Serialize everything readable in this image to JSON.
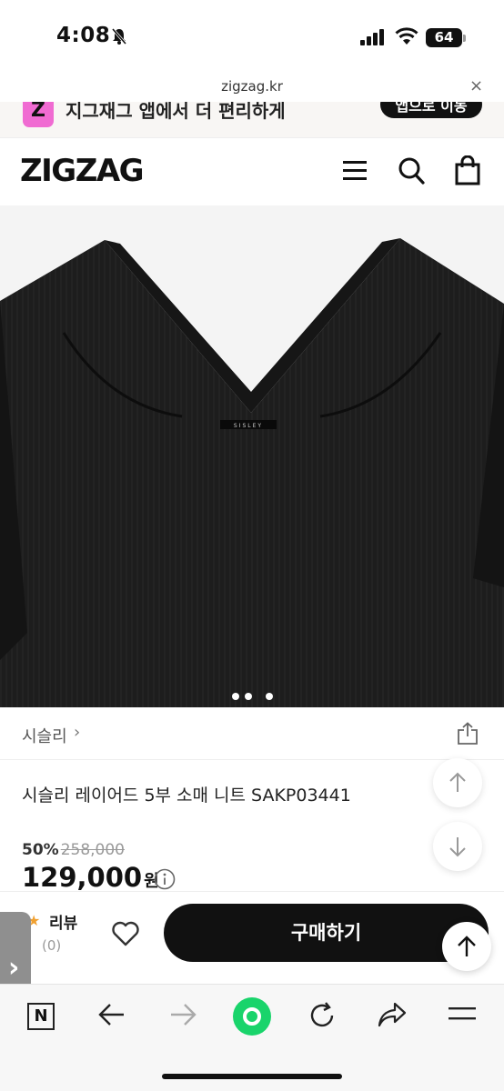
{
  "status_bar": {
    "time": "4:08",
    "battery": "64"
  },
  "url_bar": {
    "url": "zigzag.kr",
    "close": "×"
  },
  "app_banner": {
    "logo_letter": "Z",
    "text": "지그재그 앱에서 더 편리하게",
    "button_label": "앱으로 이동"
  },
  "header": {
    "logo": "ZIGZAG"
  },
  "product": {
    "image_label": "SISLEY",
    "brand": "시슬리",
    "brand_chevron": "›",
    "title": "시슬리 레이어드 5부 소매 니트 SAKP03441",
    "discount_rate": "50%",
    "original_price": "258,000",
    "price": "129,000",
    "price_unit": "원",
    "image_dot_count": 3
  },
  "purchase_bar": {
    "review_star": "★",
    "review_label": "리뷰",
    "review_count": "(0)",
    "buy_label": "구매하기"
  },
  "side_tab": {
    "label": "›"
  },
  "toolbar": {
    "n_label": "N"
  },
  "colors": {
    "accent_pink": "#f06bd2",
    "buy_button": "#111111",
    "star": "#f0a030",
    "green": "#19d46b"
  }
}
